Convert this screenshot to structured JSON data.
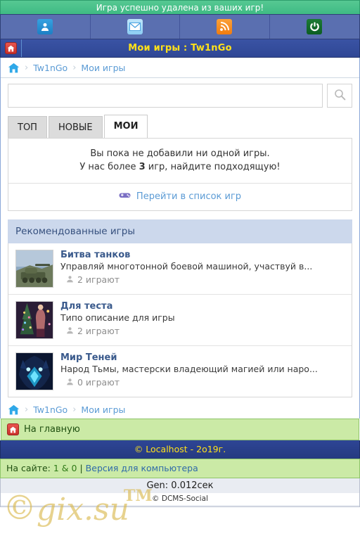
{
  "flash": {
    "message": "Игра успешно удалена из ваших игр!"
  },
  "toolbar": {
    "items": [
      {
        "icon": "user-icon",
        "name": "profile"
      },
      {
        "icon": "mail-icon",
        "name": "messages"
      },
      {
        "icon": "rss-icon",
        "name": "rss"
      },
      {
        "icon": "refresh-icon",
        "name": "refresh"
      }
    ]
  },
  "titlebar": {
    "home_icon": "home-icon",
    "title": "Мои игры : Tw1nGo"
  },
  "breadcrumb": {
    "home_icon": "home-icon",
    "separator": "›",
    "items": [
      {
        "label": "Tw1nGo"
      },
      {
        "label": "Мои игры"
      }
    ]
  },
  "search": {
    "value": "",
    "placeholder": "",
    "button_icon": "search-icon"
  },
  "tabs": [
    {
      "label": "ТОП",
      "active": false
    },
    {
      "label": "НОВЫЕ",
      "active": false
    },
    {
      "label": "МОИ",
      "active": true
    }
  ],
  "empty_panel": {
    "line1": "Вы пока не добавили ни одной игры.",
    "line2_before": "У нас более ",
    "line2_count": "3",
    "line2_after": " игр, найдите подходящую!",
    "link_icon": "gamepad-icon",
    "link_label": "Перейти в список игр"
  },
  "recommended": {
    "heading": "Рекомендованные игры",
    "players_icon": "user-icon",
    "games": [
      {
        "title": "Битва танков",
        "description": "Управляй многотонной боевой машиной, участвуй в...",
        "players": "2 играют",
        "thumb": "tank-thumbnail"
      },
      {
        "title": "Для теста",
        "description": "Типо описание для игры",
        "players": "2 играют",
        "thumb": "christmas-tree-thumbnail"
      },
      {
        "title": "Мир Теней",
        "description": "Народ Тьмы, мастерски владеющий магией или наро...",
        "players": "0 играют",
        "thumb": "shadow-wolf-thumbnail"
      }
    ]
  },
  "home_bar": {
    "icon": "home-icon",
    "label": "На главную"
  },
  "footer": {
    "copyright": "© Localhost - 2o19г.",
    "online_label": "На сайте:",
    "online_users": "1",
    "online_sep": "&",
    "online_guests": "0",
    "pipe": "|",
    "desktop_link": "Версия для компьютера",
    "gen": "Gen: 0.012сек",
    "engine": "© DCMS-Social"
  },
  "watermark": {
    "c": "©",
    "text": "gix.su",
    "tm": "TM"
  },
  "colors": {
    "flash_green": "#3fbb84",
    "toolbar_blue": "#5a6fb0",
    "title_blue": "#2f4795",
    "title_yellow": "#ffe11a",
    "link_blue": "#5b9bd5",
    "rec_head_blue": "#ccd8ec",
    "green_bar": "#cbeaa6"
  }
}
